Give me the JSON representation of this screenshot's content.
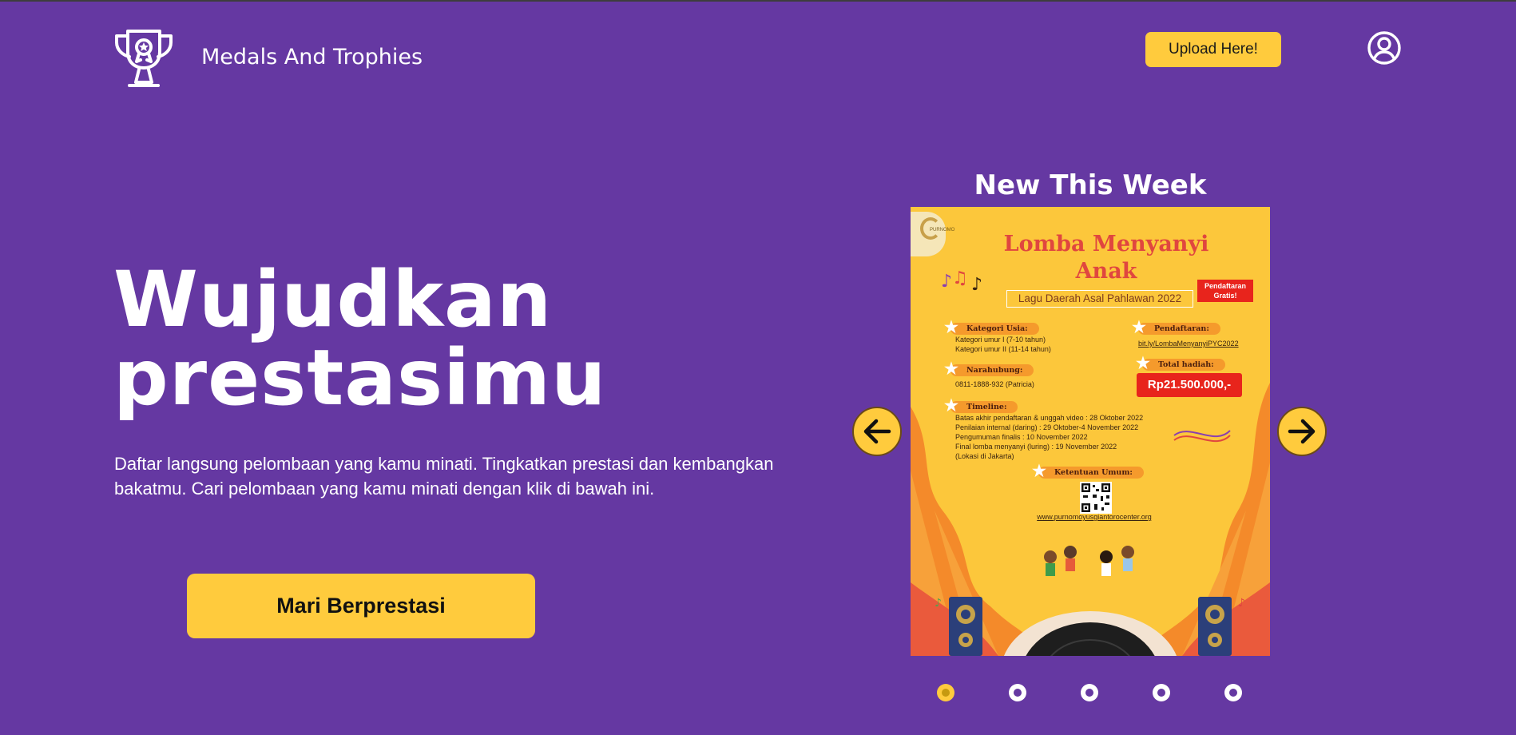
{
  "header": {
    "brand": "Medals And Trophies",
    "upload_label": "Upload Here!",
    "logo_icon": "trophy-icon",
    "profile_icon": "user-circle-icon"
  },
  "hero": {
    "title_line1": "Wujudkan",
    "title_line2": "prestasimu",
    "description": "Daftar langsung pelombaan yang kamu minati. Tingkatkan prestasi dan kembangkan bakatmu. Cari pelombaan yang kamu minati dengan klik di bawah ini.",
    "cta_label": "Mari Berprestasi"
  },
  "carousel": {
    "title": "New This Week",
    "prev_icon": "arrow-left-icon",
    "next_icon": "arrow-right-icon",
    "active_index": 0,
    "dot_count": 5,
    "poster": {
      "org": "PURNOMO",
      "title_line1": "Lomba Menyanyi",
      "title_line2": "Anak",
      "subtitle": "Lagu Daerah Asal Pahlawan 2022",
      "badge": "Pendaftaran Gratis!",
      "age_heading": "Kategori Usia:",
      "age_items": [
        "Kategori umur I (7-10 tahun)",
        "Kategori umur II (11-14 tahun)"
      ],
      "contact_heading": "Narahubung:",
      "contact": "0811-1888-932 (Patricia)",
      "timeline_heading": "Timeline:",
      "timeline_items": [
        "Batas akhir pendaftaran & unggah video : 28 Oktober 2022",
        "Penilaian internal (daring) : 29 Oktober-4 November 2022",
        "Pengumuman finalis : 10 November 2022",
        "Final lomba menyanyi (luring) : 19 November 2022",
        "(Lokasi di Jakarta)"
      ],
      "registration_heading": "Pendaftaran:",
      "registration_link": "bit.ly/LombaMenyanyiPYC2022",
      "prize_heading": "Total hadiah:",
      "prize": "Rp21.500.000,-",
      "terms_heading": "Ketentuan Umum:",
      "website": "www.purnomoyusgiantorocenter.org"
    }
  },
  "colors": {
    "background": "#6538a2",
    "accent": "#ffcb3d",
    "poster_bg": "#fcc73b",
    "poster_red": "#e8241c"
  }
}
